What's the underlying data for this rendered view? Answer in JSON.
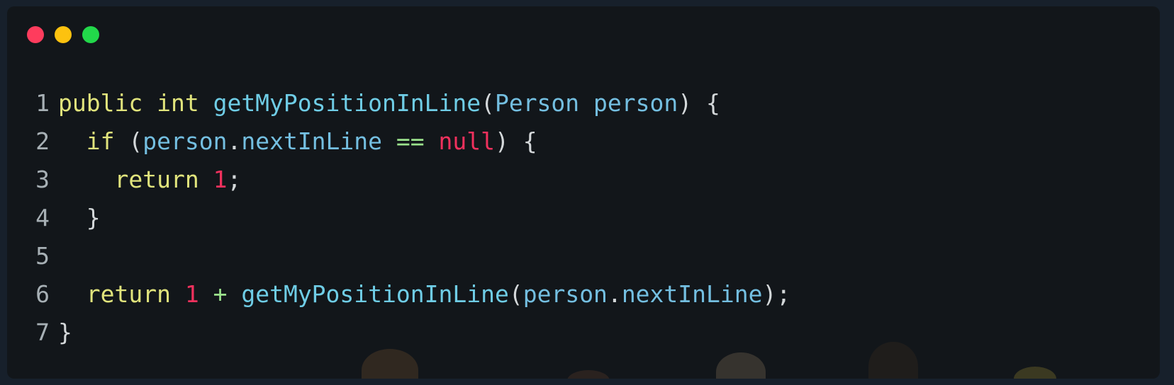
{
  "window": {
    "controls": [
      {
        "name": "close",
        "color": "#fe3c5d"
      },
      {
        "name": "minimize",
        "color": "#fdc20f"
      },
      {
        "name": "maximize",
        "color": "#22d84a"
      }
    ]
  },
  "code": {
    "lines": [
      {
        "number": "1",
        "tokens": [
          {
            "t": "public",
            "c": "kw"
          },
          {
            "t": " ",
            "c": "plain"
          },
          {
            "t": "int",
            "c": "kw"
          },
          {
            "t": " ",
            "c": "plain"
          },
          {
            "t": "getMyPositionInLine",
            "c": "fn"
          },
          {
            "t": "(",
            "c": "pun"
          },
          {
            "t": "Person",
            "c": "id"
          },
          {
            "t": " ",
            "c": "plain"
          },
          {
            "t": "person",
            "c": "id"
          },
          {
            "t": ")",
            "c": "pun"
          },
          {
            "t": " {",
            "c": "pun"
          }
        ]
      },
      {
        "number": "2",
        "tokens": [
          {
            "t": "  ",
            "c": "plain"
          },
          {
            "t": "if",
            "c": "kw"
          },
          {
            "t": " ",
            "c": "plain"
          },
          {
            "t": "(",
            "c": "pun"
          },
          {
            "t": "person",
            "c": "id"
          },
          {
            "t": ".",
            "c": "pun"
          },
          {
            "t": "nextInLine",
            "c": "id"
          },
          {
            "t": " ",
            "c": "plain"
          },
          {
            "t": "==",
            "c": "op"
          },
          {
            "t": " ",
            "c": "plain"
          },
          {
            "t": "null",
            "c": "num"
          },
          {
            "t": ")",
            "c": "pun"
          },
          {
            "t": " {",
            "c": "pun"
          }
        ]
      },
      {
        "number": "3",
        "tokens": [
          {
            "t": "    ",
            "c": "plain"
          },
          {
            "t": "return",
            "c": "kw"
          },
          {
            "t": " ",
            "c": "plain"
          },
          {
            "t": "1",
            "c": "num"
          },
          {
            "t": ";",
            "c": "pun"
          }
        ]
      },
      {
        "number": "4",
        "tokens": [
          {
            "t": "  ",
            "c": "plain"
          },
          {
            "t": "}",
            "c": "pun"
          }
        ]
      },
      {
        "number": "5",
        "tokens": []
      },
      {
        "number": "6",
        "tokens": [
          {
            "t": "  ",
            "c": "plain"
          },
          {
            "t": "return",
            "c": "kw"
          },
          {
            "t": " ",
            "c": "plain"
          },
          {
            "t": "1",
            "c": "num"
          },
          {
            "t": " ",
            "c": "plain"
          },
          {
            "t": "+",
            "c": "op"
          },
          {
            "t": " ",
            "c": "plain"
          },
          {
            "t": "getMyPositionInLine",
            "c": "fn"
          },
          {
            "t": "(",
            "c": "pun"
          },
          {
            "t": "person",
            "c": "id"
          },
          {
            "t": ".",
            "c": "pun"
          },
          {
            "t": "nextInLine",
            "c": "id"
          },
          {
            "t": ")",
            "c": "pun"
          },
          {
            "t": ";",
            "c": "pun"
          }
        ]
      },
      {
        "number": "7",
        "tokens": [
          {
            "t": "}",
            "c": "pun"
          }
        ]
      }
    ]
  },
  "colors": {
    "background": "#12161a",
    "keyword": "#e1e47c",
    "function": "#6fcde6",
    "identifier": "#74bfe1",
    "operator": "#9be28c",
    "literal": "#f0315d",
    "punctuation": "#d4d8da",
    "line_number": "#a7b0b5"
  }
}
